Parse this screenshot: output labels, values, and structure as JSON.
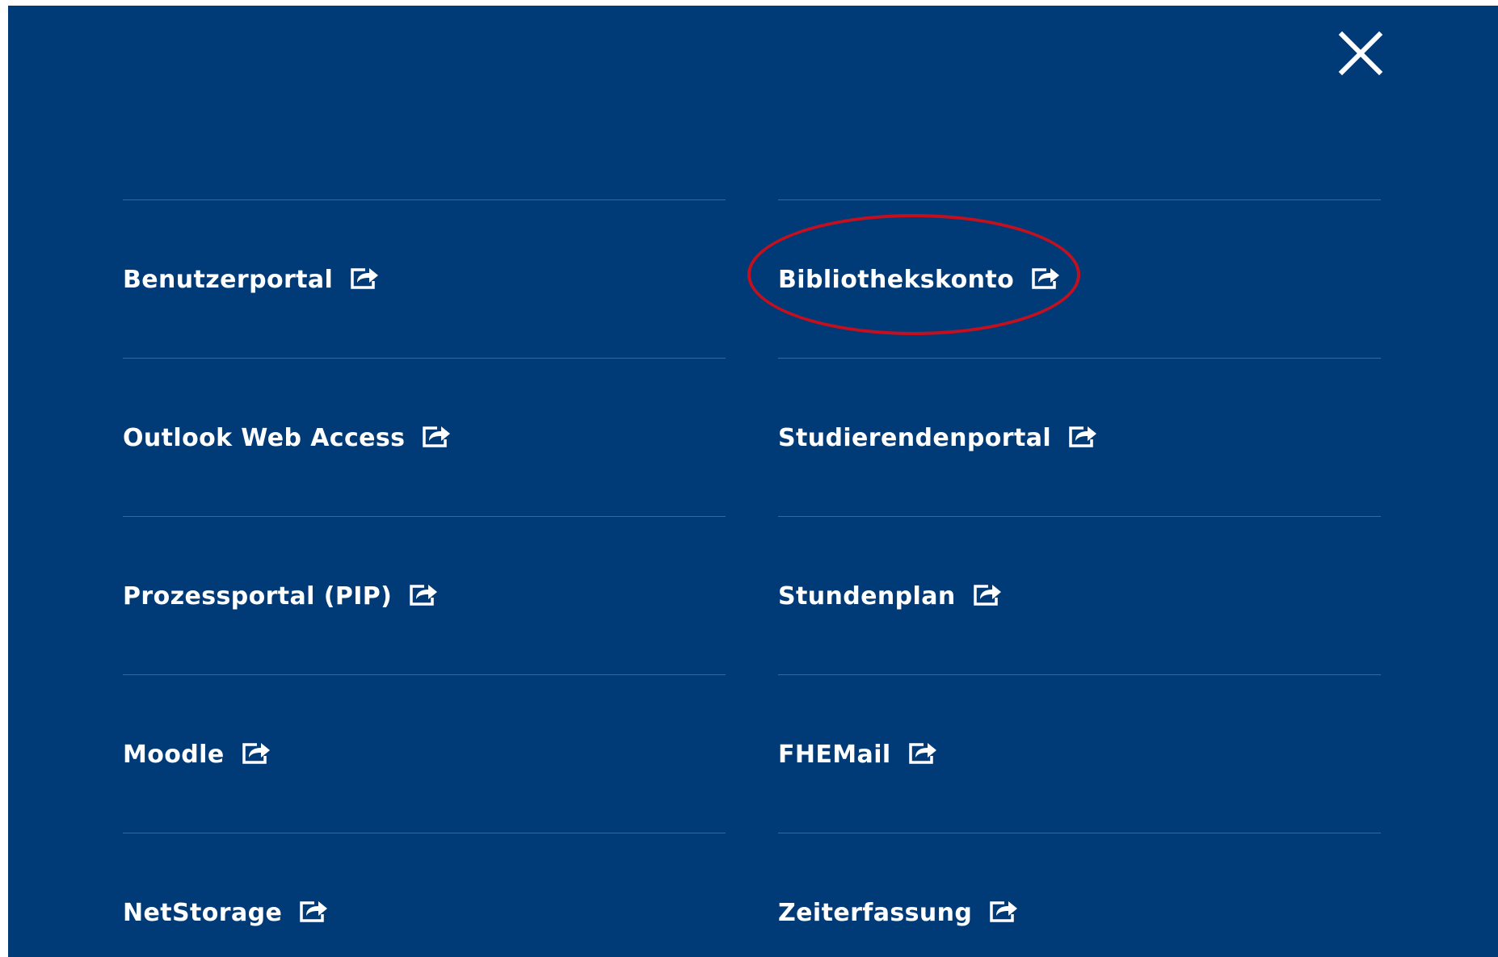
{
  "menu": {
    "close_label": "Close",
    "close_icon": "close-icon",
    "columns": [
      {
        "items": [
          {
            "label": "Benutzerportal",
            "icon": "external-link-icon"
          },
          {
            "label": "Outlook Web Access",
            "icon": "external-link-icon"
          },
          {
            "label": "Prozessportal (PIP)",
            "icon": "external-link-icon"
          },
          {
            "label": "Moodle",
            "icon": "external-link-icon"
          },
          {
            "label": "NetStorage",
            "icon": "external-link-icon"
          }
        ]
      },
      {
        "items": [
          {
            "label": "Bibliothekskonto",
            "icon": "external-link-icon",
            "highlighted": true
          },
          {
            "label": "Studierendenportal",
            "icon": "external-link-icon"
          },
          {
            "label": "Stundenplan",
            "icon": "external-link-icon"
          },
          {
            "label": "FHEMail",
            "icon": "external-link-icon"
          },
          {
            "label": "Zeiterfassung",
            "icon": "external-link-icon"
          }
        ]
      }
    ]
  },
  "colors": {
    "background": "#003b78",
    "text": "#ffffff",
    "divider": "rgba(255,255,255,0.22)",
    "highlight_ring": "#c4101e"
  }
}
